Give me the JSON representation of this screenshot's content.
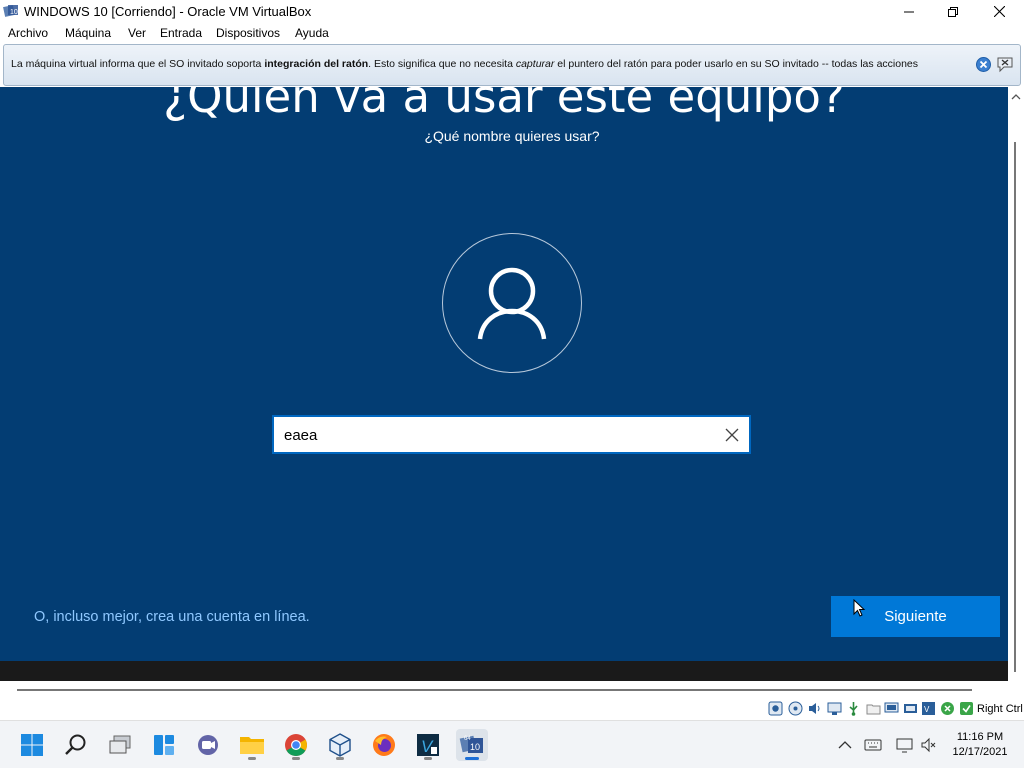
{
  "window": {
    "title": "WINDOWS 10 [Corriendo] - Oracle VM VirtualBox"
  },
  "menu": {
    "items": [
      "Archivo",
      "Máquina",
      "Ver",
      "Entrada",
      "Dispositivos",
      "Ayuda"
    ]
  },
  "notification": {
    "text_pre": "La máquina virtual informa que el SO invitado soporta ",
    "text_bold": "integración del ratón",
    "text_mid": ". Esto significa que no necesita ",
    "text_italic": "capturar",
    "text_post": " el puntero del ratón para poder usarlo en su SO invitado -- todas las acciones"
  },
  "oobe": {
    "heading": "¿Quién va a usar este equipo?",
    "subheading": "¿Qué nombre quieres usar?",
    "name_value": "eaea",
    "online_account_link": "O, incluso mejor, crea una cuenta en línea.",
    "next_button": "Siguiente",
    "background_color": "#033d73",
    "accent_color": "#0078d7"
  },
  "statusbar": {
    "host_key": "Right Ctrl",
    "icons": [
      "hard-disk-icon",
      "optical-drive-icon",
      "audio-icon",
      "network-icon",
      "usb-icon",
      "shared-folders-icon",
      "display-icon",
      "recording-icon",
      "cpu-icon",
      "mouse-integration-icon",
      "keyboard-capture-icon"
    ]
  },
  "taskbar": {
    "apps": [
      "start-icon",
      "search-icon",
      "task-view-icon",
      "widgets-icon",
      "chat-icon",
      "file-explorer-icon",
      "chrome-icon",
      "virtualbox-icon",
      "firefox-icon",
      "vim-icon",
      "virtualbox-vm-icon"
    ],
    "time": "11:16 PM",
    "date": "12/17/2021"
  }
}
